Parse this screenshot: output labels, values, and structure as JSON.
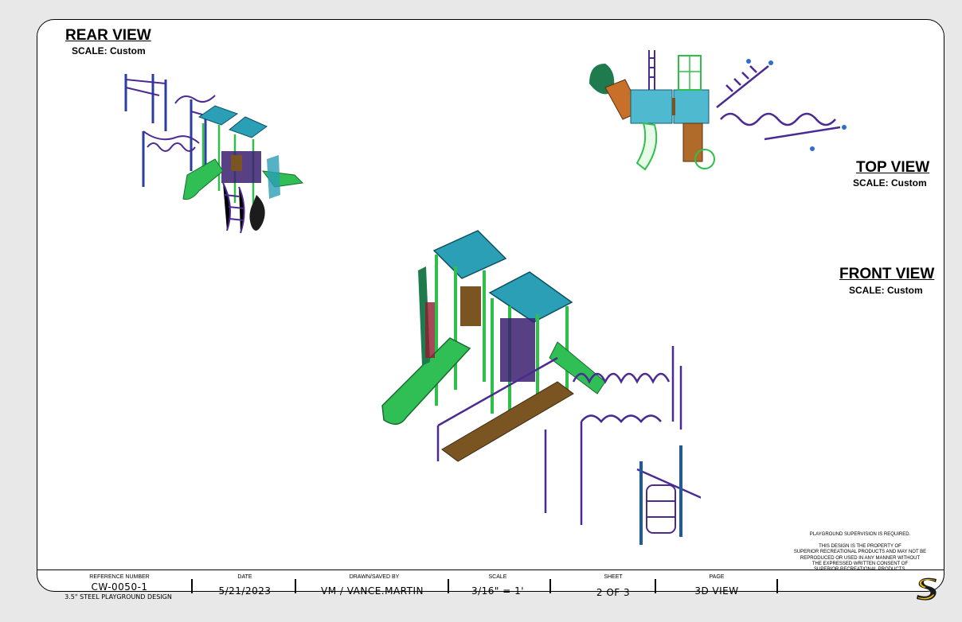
{
  "views": {
    "rear": {
      "title": "REAR VIEW",
      "scale": "SCALE: Custom"
    },
    "top": {
      "title": "TOP VIEW",
      "scale": "SCALE: Custom"
    },
    "front": {
      "title": "FRONT VIEW",
      "scale": "SCALE: Custom"
    }
  },
  "notes": {
    "supervision": "PLAYGROUND SUPERVISION IS REQUIRED.",
    "property_lines": [
      "THIS DESIGN IS THE PROPERTY OF",
      "SUPERIOR RECREATIONAL PRODUCTS AND MAY NOT BE",
      "REPRODUCED OR USED IN ANY MANNER WITHOUT",
      "THE EXPRESSED WRITTEN CONSENT OF",
      "SUPERIOR RECREATIONAL PRODUCTS."
    ]
  },
  "title_block": {
    "reference_label": "REFERENCE NUMBER",
    "reference_value": "CW-0050-1",
    "reference_desc": "3.5\" STEEL PLAYGROUND DESIGN",
    "date_label": "DATE",
    "date_value": "5/21/2023",
    "drawn_label": "DRAWN/SAVED BY",
    "drawn_value": "VM / VANCE.MARTIN",
    "scale_label": "SCALE",
    "scale_value": "3/16\" = 1'",
    "sheet_label": "SHEET",
    "sheet_value": "2 OF 3",
    "page_label": "PAGE",
    "page_value": "3D-VIEW"
  },
  "logo": {
    "icon": "superior-s-logo-icon",
    "color_primary": "#f2c400",
    "color_dark": "#1a1a1a"
  },
  "colors": {
    "roof": "#2a9fb5",
    "post_blue": "#2a3f9f",
    "post_green": "#2fc04a",
    "slide_green": "#2fbf55",
    "climber_purple": "#4b2a91",
    "deck_brown": "#7a5522",
    "tube_dark": "#1c1c1c"
  }
}
